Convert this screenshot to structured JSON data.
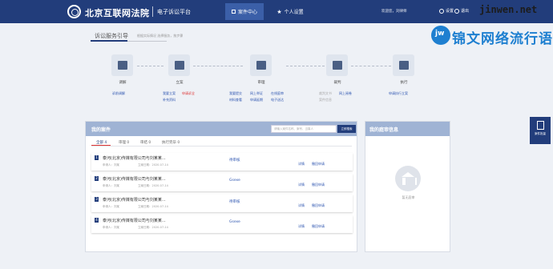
{
  "header": {
    "brand": "北京互联网法院",
    "subtitle": "电子诉讼平台",
    "nav": [
      {
        "label": "案件中心",
        "active": true
      },
      {
        "label": "个人设置",
        "active": false
      }
    ],
    "welcome": "欢迎您，刘律师",
    "settings": "设置",
    "logout": "退出"
  },
  "watermark": {
    "url": "jinwen.net",
    "text": "锦文网络流行语"
  },
  "service": {
    "title": "诉讼服务引导",
    "subtitle": "根据实际情况 选择服务，按步骤"
  },
  "steps": [
    {
      "name": "调解",
      "links": [
        {
          "text": "诉前调解",
          "style": "blue"
        }
      ]
    },
    {
      "name": "立案",
      "links": [
        {
          "text": "我要立案",
          "style": "blue"
        },
        {
          "text": "申请诉全",
          "style": "red"
        },
        {
          "text": "补充资料",
          "style": "blue"
        }
      ]
    },
    {
      "name": "审理",
      "links": [
        {
          "text": "我要提交",
          "style": "blue"
        },
        {
          "text": "网上举证",
          "style": "blue"
        },
        {
          "text": "在线庭审",
          "style": "blue"
        },
        {
          "text": "材料查看",
          "style": "blue"
        },
        {
          "text": "申请延期",
          "style": "blue"
        },
        {
          "text": "电子送达",
          "style": "blue"
        }
      ]
    },
    {
      "name": "裁判",
      "links": [
        {
          "text": "裁判文书",
          "style": "gray"
        },
        {
          "text": "网上阅卷",
          "style": "blue"
        },
        {
          "text": "案件信息",
          "style": "gray"
        }
      ]
    },
    {
      "name": "执行",
      "links": [
        {
          "text": "申请执行立案",
          "style": "blue"
        }
      ]
    }
  ],
  "side_tab": {
    "label": "案件批量"
  },
  "cases": {
    "title": "我的案件",
    "search_placeholder": "请输入案件名称、案号、当事人",
    "search_button": "立即搜索",
    "tabs": [
      {
        "label": "全部 4",
        "active": true
      },
      {
        "label": "审理 0",
        "active": false
      },
      {
        "label": "审结 0",
        "active": false
      },
      {
        "label": "执行完毕 0",
        "active": false
      }
    ],
    "rows": [
      {
        "no": "1",
        "name": "泰河(北京)传媒有限公司与刘某某...",
        "meta": "申请人：刘某",
        "date": "立案日期：2020-07-14",
        "status": "待审核",
        "actions": [
          "详情",
          "撤回申请"
        ]
      },
      {
        "no": "2",
        "name": "泰河(北京)传媒有限公司与刘某某...",
        "meta": "申请人：刘某",
        "date": "立案日期：2020-07-14",
        "status": "Gsexe",
        "actions": [
          "详情",
          "撤回申请"
        ]
      },
      {
        "no": "3",
        "name": "泰河(北京)传媒有限公司与刘某某...",
        "meta": "申请人：刘某",
        "date": "立案日期：2020-07-14",
        "status": "待审核",
        "actions": [
          "详情",
          "撤回申请"
        ]
      },
      {
        "no": "4",
        "name": "泰河(北京)传媒有限公司与刘某某...",
        "meta": "申请人：刘某",
        "date": "立案日期：2020-07-14",
        "status": "Gsexe",
        "actions": [
          "详情",
          "撤回申请"
        ]
      }
    ]
  },
  "hearings": {
    "title": "我的庭审信息",
    "empty": "暂无庭审"
  },
  "icons": [
    "logo-icon",
    "briefcase-icon",
    "star-icon",
    "settings-icon",
    "power-icon",
    "mediation-icon",
    "filing-icon",
    "court-icon",
    "judgment-icon",
    "execution-icon",
    "document-icon"
  ]
}
